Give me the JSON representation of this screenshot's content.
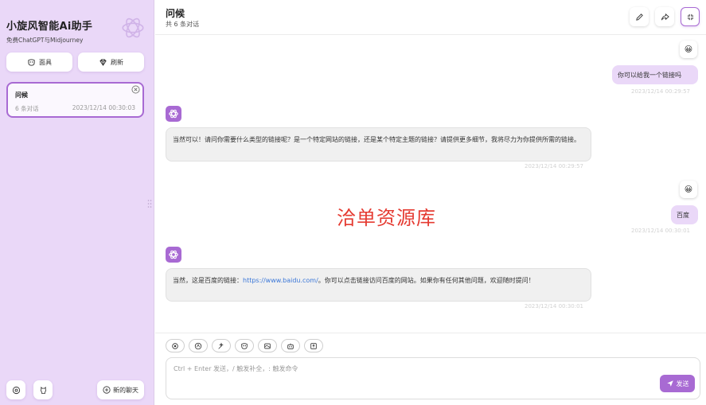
{
  "sidebar": {
    "brand_title": "小旋风智能Ai助手",
    "brand_subtitle": "免费ChatGPT与Midjourney",
    "mask_button": "面具",
    "refresh_button": "刷新",
    "chat_item": {
      "title": "问候",
      "count": "6 条对话",
      "time": "2023/12/14 00:30:03"
    },
    "new_chat_button": "新的聊天"
  },
  "header": {
    "title": "问候",
    "subtitle": "共 6 条对话"
  },
  "messages": [
    {
      "role": "user",
      "emoji": "😀",
      "text": "你可以给我一个链接吗",
      "time": "2023/12/14 00:29:57"
    },
    {
      "role": "assistant",
      "text": "当然可以！请问你需要什么类型的链接呢？是一个特定网站的链接，还是某个特定主题的链接？请提供更多细节，我将尽力为你提供所需的链接。",
      "time": "2023/12/14 00:29:57"
    },
    {
      "role": "user",
      "emoji": "😀",
      "text": "百度",
      "time": "2023/12/14 00:30:01"
    },
    {
      "role": "assistant",
      "text_before": "当然，这是百度的链接：",
      "link": "https://www.baidu.com/",
      "text_after": "。你可以点击链接访问百度的网站。如果你有任何其他问题，欢迎随时提问！",
      "time": "2023/12/14 00:30:01"
    }
  ],
  "watermark": "洽单资源库",
  "composer": {
    "placeholder": "Ctrl + Enter 发送，/ 触发补全，: 触发命令",
    "send_label": "发送",
    "tools": [
      "settings-icon",
      "theme-icon",
      "prompt-icon",
      "mask-icon",
      "image-icon",
      "robot-icon",
      "upload-icon"
    ]
  },
  "colors": {
    "accent": "#a86ad3",
    "sidebar_bg": "#ead8f8",
    "user_bubble": "#ead8f8",
    "bot_bubble": "#f0f0f0",
    "watermark": "#e53b32",
    "link": "#3b77d8"
  }
}
